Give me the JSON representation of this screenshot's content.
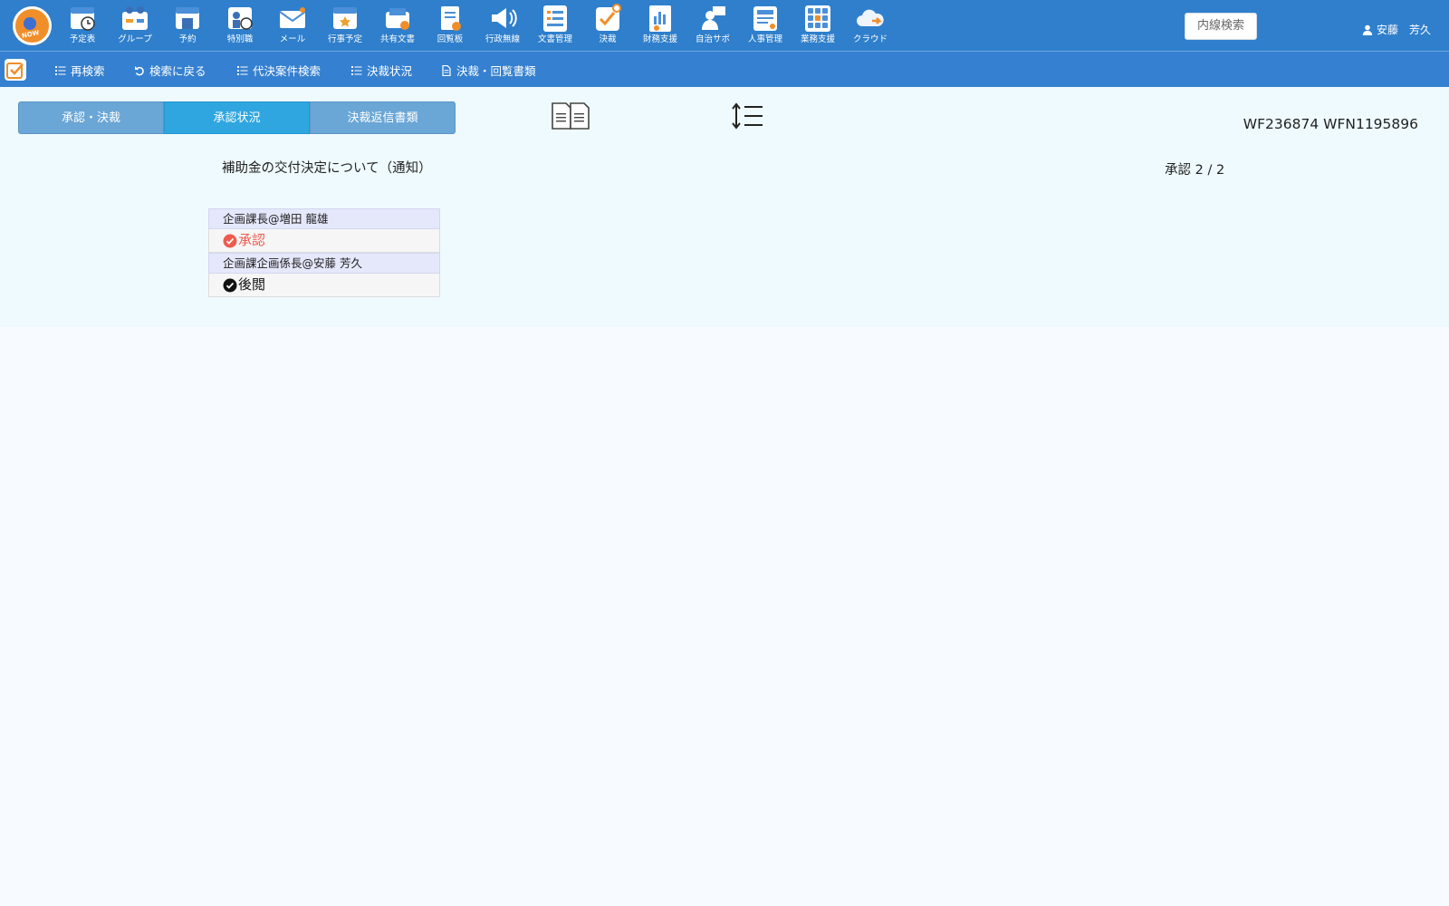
{
  "logo": {
    "text": "NOW"
  },
  "apps": [
    {
      "label": "予定表",
      "icon": "schedule-icon"
    },
    {
      "label": "グループ",
      "icon": "group-icon"
    },
    {
      "label": "予約",
      "icon": "reservation-icon"
    },
    {
      "label": "特別職",
      "icon": "special-staff-icon"
    },
    {
      "label": "メール",
      "icon": "mail-icon"
    },
    {
      "label": "行事予定",
      "icon": "event-icon"
    },
    {
      "label": "共有文書",
      "icon": "shared-docs-icon"
    },
    {
      "label": "回覧板",
      "icon": "circular-icon"
    },
    {
      "label": "行政無線",
      "icon": "radio-icon"
    },
    {
      "label": "文書管理",
      "icon": "doc-management-icon"
    },
    {
      "label": "決裁",
      "icon": "approval-icon"
    },
    {
      "label": "財務支援",
      "icon": "finance-icon"
    },
    {
      "label": "自治サポ",
      "icon": "community-icon"
    },
    {
      "label": "人事管理",
      "icon": "hr-icon"
    },
    {
      "label": "業務支援",
      "icon": "business-icon"
    },
    {
      "label": "クラウド",
      "icon": "cloud-icon"
    }
  ],
  "header": {
    "extension_search": "内線検索",
    "user_name": "安藤　芳久"
  },
  "toolbar": {
    "items": [
      {
        "label": "再検索",
        "icon": "list-icon"
      },
      {
        "label": "検索に戻る",
        "icon": "undo-icon"
      },
      {
        "label": "代決案件検索",
        "icon": "list-icon"
      },
      {
        "label": "決裁状況",
        "icon": "list-icon"
      },
      {
        "label": "決裁・回覧書類",
        "icon": "document-icon"
      }
    ]
  },
  "tabs": [
    {
      "label": "承認・決裁",
      "active": false
    },
    {
      "label": "承認状況",
      "active": true
    },
    {
      "label": "決裁返信書類",
      "active": false
    }
  ],
  "document": {
    "id": "WF236874 WFN1195896",
    "title": "補助金の交付決定について（通知）",
    "approval_count": "承認 2 / 2"
  },
  "approvers": [
    {
      "name": "企画課長@増田 龍雄",
      "status": "承認",
      "status_color": "#ef5b4f"
    },
    {
      "name": "企画課企画係長@安藤 芳久",
      "status": "後閲",
      "status_color": "#111111"
    }
  ],
  "colors": {
    "topbar": "#2f7fcc",
    "subbar": "#3580d0",
    "tab": "#6aa6d6",
    "tab_active": "#2fa6e0",
    "content_bg": "#effafe"
  }
}
